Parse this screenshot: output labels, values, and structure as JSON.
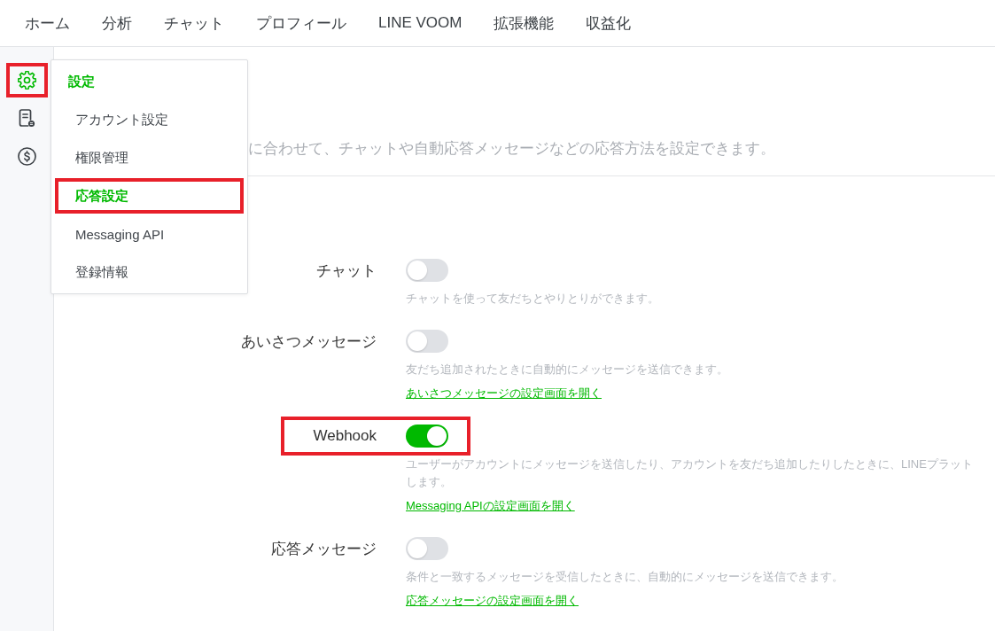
{
  "top_nav": {
    "items": [
      {
        "label": "ホーム"
      },
      {
        "label": "分析"
      },
      {
        "label": "チャット"
      },
      {
        "label": "プロフィール"
      },
      {
        "label": "LINE VOOM"
      },
      {
        "label": "拡張機能"
      },
      {
        "label": "収益化"
      }
    ]
  },
  "sidebar": {
    "items": [
      {
        "selected": true,
        "highlighted": true
      },
      {
        "selected": false,
        "highlighted": false
      },
      {
        "selected": false,
        "highlighted": false
      }
    ]
  },
  "settings_menu": {
    "title": "設定",
    "items": [
      {
        "label": "アカウント設定",
        "selected": false,
        "highlighted": false
      },
      {
        "label": "権限管理",
        "selected": false,
        "highlighted": false
      },
      {
        "label": "応答設定",
        "selected": true,
        "highlighted": true
      },
      {
        "label": "Messaging API",
        "selected": false,
        "highlighted": false
      },
      {
        "label": "登録情報",
        "selected": false,
        "highlighted": false
      }
    ]
  },
  "page_description": "に合わせて、チャットや自動応答メッセージなどの応答方法を設定できます。",
  "settings": [
    {
      "label": "チャット",
      "on": false,
      "highlighted": false,
      "description_lines": [
        "チャットを使って友だちとやりとりができます。"
      ]
    },
    {
      "label": "あいさつメッセージ",
      "on": false,
      "highlighted": false,
      "description_lines": [
        "友だち追加されたときに自動的にメッセージを送信できます。"
      ],
      "link": "あいさつメッセージの設定画面を開く"
    },
    {
      "label": "Webhook",
      "on": true,
      "highlighted": true,
      "description_lines": [
        "ユーザーがアカウントにメッセージを送信したり、アカウントを友だち追加したりしたときに、LINEプラット",
        "します。"
      ],
      "link": "Messaging APIの設定画面を開く"
    },
    {
      "label": "応答メッセージ",
      "on": false,
      "highlighted": false,
      "description_lines": [
        "条件と一致するメッセージを受信したときに、自動的にメッセージを送信できます。"
      ],
      "link": "応答メッセージの設定画面を開く"
    }
  ]
}
